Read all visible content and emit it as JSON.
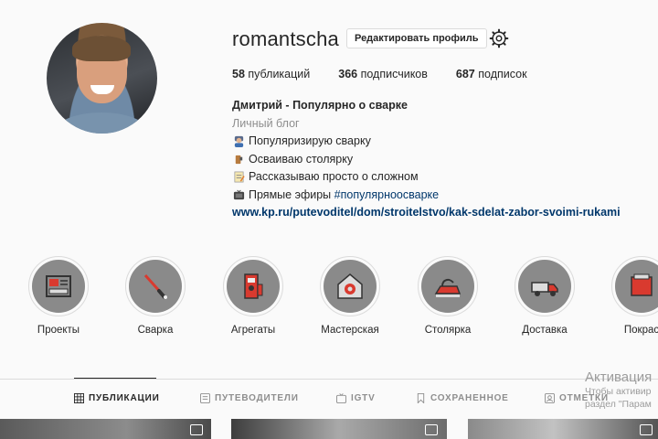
{
  "profile": {
    "username": "romantscha",
    "edit_label": "Редактировать профиль",
    "settings_icon": "gear-icon"
  },
  "stats": [
    {
      "count": "58",
      "label": "публикаций"
    },
    {
      "count": "366",
      "label": "подписчиков"
    },
    {
      "count": "687",
      "label": "подписок"
    }
  ],
  "bio": {
    "name": "Дмитрий - Популярно о сварке",
    "category": "Личный блог",
    "lines": [
      {
        "icon": "welder-emoji",
        "text": "Популяризирую сварку"
      },
      {
        "icon": "saw-emoji",
        "text": "Осваиваю столярку"
      },
      {
        "icon": "memo-emoji",
        "text": "Рассказываю просто о сложном"
      },
      {
        "icon": "tv-emoji",
        "text": "Прямые эфиры ",
        "hashtag": "#популярноосварке"
      }
    ],
    "link": "www.kp.ru/putevoditel/dom/stroitelstvo/kak-sdelat-zabor-svoimi-rukami"
  },
  "highlights": [
    {
      "label": "Проекты",
      "icon": "blueprint-icon"
    },
    {
      "label": "Сварка",
      "icon": "welding-torch-icon"
    },
    {
      "label": "Агрегаты",
      "icon": "welding-machine-icon"
    },
    {
      "label": "Мастерская",
      "icon": "workshop-icon"
    },
    {
      "label": "Столярка",
      "icon": "plane-tool-icon"
    },
    {
      "label": "Доставка",
      "icon": "truck-icon"
    },
    {
      "label": "Покрас",
      "icon": "paint-icon"
    }
  ],
  "tabs": [
    {
      "label": "ПУБЛИКАЦИИ",
      "icon": "grid-icon",
      "active": true
    },
    {
      "label": "ПУТЕВОДИТЕЛИ",
      "icon": "guide-icon",
      "active": false
    },
    {
      "label": "IGTV",
      "icon": "igtv-icon",
      "active": false
    },
    {
      "label": "СОХРАНЕННОЕ",
      "icon": "bookmark-icon",
      "active": false
    },
    {
      "label": "ОТМЕТКИ",
      "icon": "tag-icon",
      "active": false
    }
  ],
  "watermark": {
    "title": "Активация",
    "line1": "Чтобы активир",
    "line2": "раздел \"Парам"
  },
  "colors": {
    "accent_red": "#d93a2f",
    "link": "#00376b",
    "muted": "#8e8e8e"
  }
}
